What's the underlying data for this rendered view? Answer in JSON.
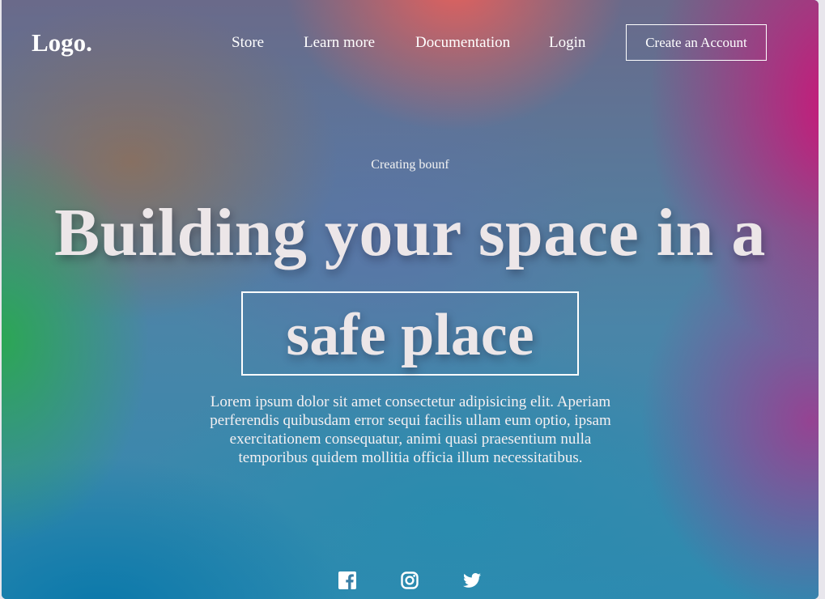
{
  "nav": {
    "logo": "Logo.",
    "links": [
      "Store",
      "Learn more",
      "Documentation",
      "Login"
    ],
    "cta_label": "Create an Account"
  },
  "hero": {
    "eyebrow": "Creating bounf",
    "headline": "Building your space in a",
    "highlight": "safe place",
    "description": "Lorem ipsum dolor sit amet consectetur adipisicing elit. Aperiam perferendis quibusdam error sequi facilis ullam eum optio, ipsam exercitationem consequatur, animi quasi praesentium nulla temporibus quidem mollitia officia illum necessitatibus."
  },
  "socials": {
    "icons": [
      "facebook-icon",
      "instagram-icon",
      "twitter-icon"
    ]
  },
  "colors": {
    "text": "#ffffff",
    "headline": "#ece6e8",
    "gradient_green": "#2aa850",
    "gradient_coral": "#e8605a",
    "gradient_magenta": "#cd1478",
    "gradient_blue": "#0a78aa"
  }
}
